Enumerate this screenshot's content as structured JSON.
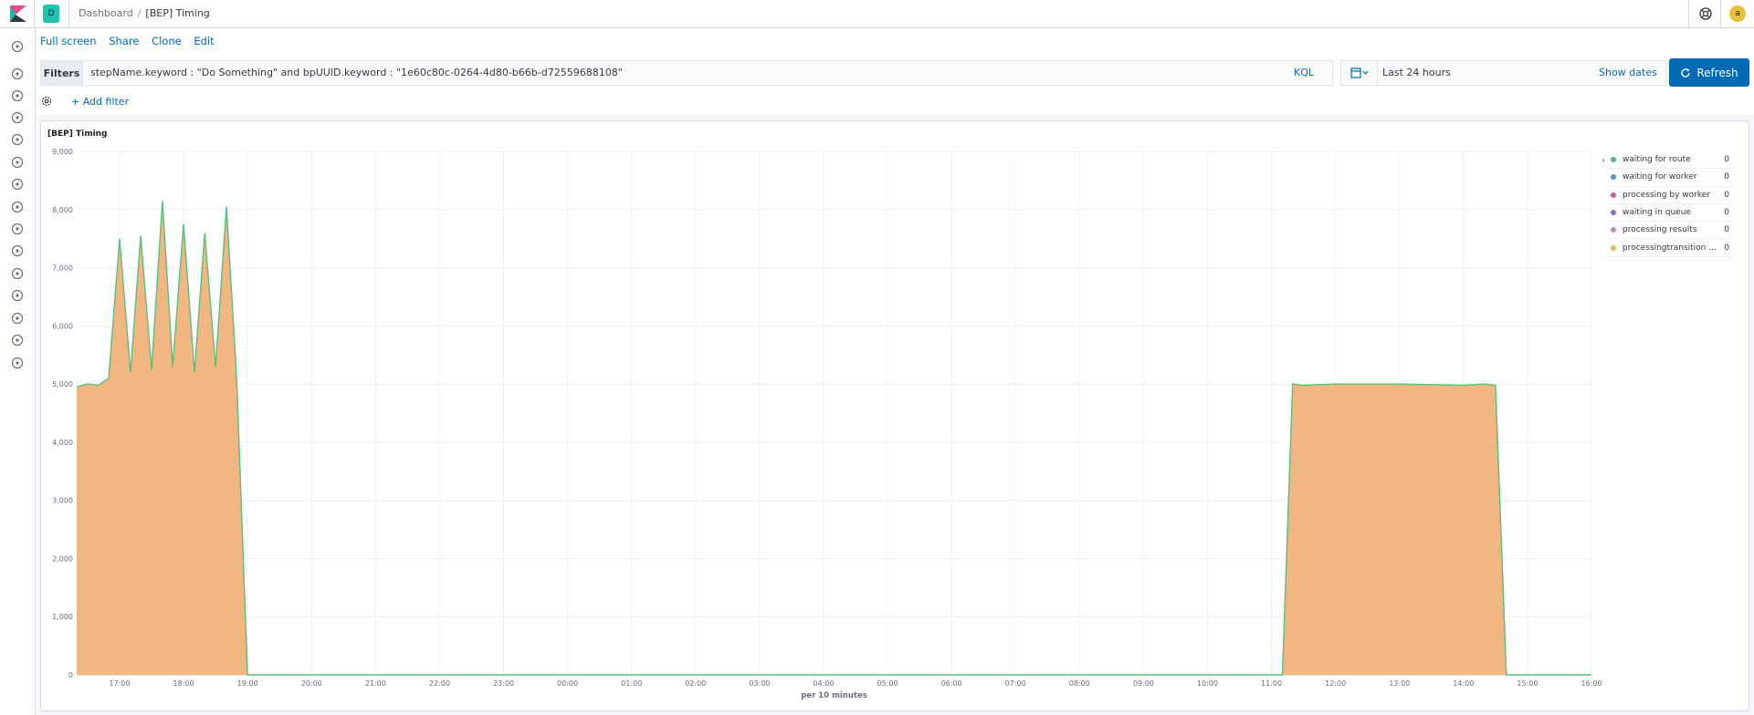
{
  "header": {
    "space_initial": "D",
    "breadcrumbs": [
      "Dashboard",
      "[BEP] Timing"
    ],
    "avatar_initial": "a"
  },
  "topnav": [
    "Full screen",
    "Share",
    "Clone",
    "Edit"
  ],
  "querybar": {
    "filters_label": "Filters",
    "query": "stepName.keyword : \"Do Something\" and bpUUID.keyword : \"1e60c80c-0264-4d80-b66b-d72559688108\"",
    "language": "KQL",
    "time_range": "Last 24 hours",
    "show_dates": "Show dates",
    "refresh": "Refresh"
  },
  "filterbar": {
    "add_filter": "+ Add filter"
  },
  "sidenav": [
    "clock-icon",
    "discover-icon",
    "visualize-icon",
    "dashboard-icon",
    "canvas-icon",
    "maps-icon",
    "ml-icon",
    "infrastructure-icon",
    "logs-icon",
    "apm-icon",
    "siem-icon",
    "graph-icon",
    "dev-tools-icon",
    "monitoring-icon",
    "management-icon"
  ],
  "panel": {
    "title": "[BEP] Timing",
    "legend": [
      {
        "label": "waiting for route",
        "value": "0",
        "color": "#54b399"
      },
      {
        "label": "waiting for worker",
        "value": "0",
        "color": "#6092c0"
      },
      {
        "label": "processing by worker",
        "value": "0",
        "color": "#d36086"
      },
      {
        "label": "waiting in queue",
        "value": "0",
        "color": "#9170b8"
      },
      {
        "label": "processing results",
        "value": "0",
        "color": "#ca8eae"
      },
      {
        "label": "processingtransition ...",
        "value": "0",
        "color": "#d6bf57"
      }
    ]
  },
  "colors": {
    "accent": "#006bb4",
    "area_fill": "#f0b27a",
    "line_green": "#57c17b"
  },
  "chart_data": {
    "type": "area",
    "title": "",
    "xlabel": "per 10 minutes",
    "ylabel": "",
    "ylim": [
      0,
      9000
    ],
    "yticks": [
      "0",
      "1,000",
      "2,000",
      "3,000",
      "4,000",
      "5,000",
      "6,000",
      "7,000",
      "8,000",
      "9,000"
    ],
    "xticks": [
      "17:00",
      "18:00",
      "19:00",
      "20:00",
      "21:00",
      "22:00",
      "23:00",
      "00:00",
      "01:00",
      "02:00",
      "03:00",
      "04:00",
      "05:00",
      "06:00",
      "07:00",
      "08:00",
      "09:00",
      "10:00",
      "11:00",
      "12:00",
      "13:00",
      "14:00",
      "15:00",
      "16:00"
    ],
    "grid": true,
    "legend_position": "right",
    "x_hours": [
      16.33,
      16.5,
      16.67,
      16.83,
      17.0,
      17.17,
      17.33,
      17.5,
      17.67,
      17.83,
      18.0,
      18.17,
      18.33,
      18.5,
      18.67,
      18.83,
      19.0,
      19.17,
      20.0,
      21.0,
      22.0,
      23.0,
      24.0,
      25.0,
      26.0,
      27.0,
      28.0,
      29.0,
      30.0,
      31.0,
      32.0,
      33.0,
      34.0,
      35.0,
      35.17,
      35.33,
      35.5,
      36.0,
      37.0,
      38.0,
      38.33,
      38.5,
      38.67,
      38.83,
      40.0
    ],
    "values": [
      4950,
      5000,
      4980,
      5100,
      7500,
      5200,
      7550,
      5250,
      8150,
      5300,
      7750,
      5200,
      7600,
      5300,
      8050,
      5100,
      0,
      0,
      0,
      0,
      0,
      0,
      0,
      0,
      0,
      0,
      0,
      0,
      0,
      0,
      0,
      0,
      0,
      0,
      0,
      5000,
      4980,
      5000,
      5000,
      4980,
      5000,
      4980,
      0,
      0,
      0
    ]
  }
}
